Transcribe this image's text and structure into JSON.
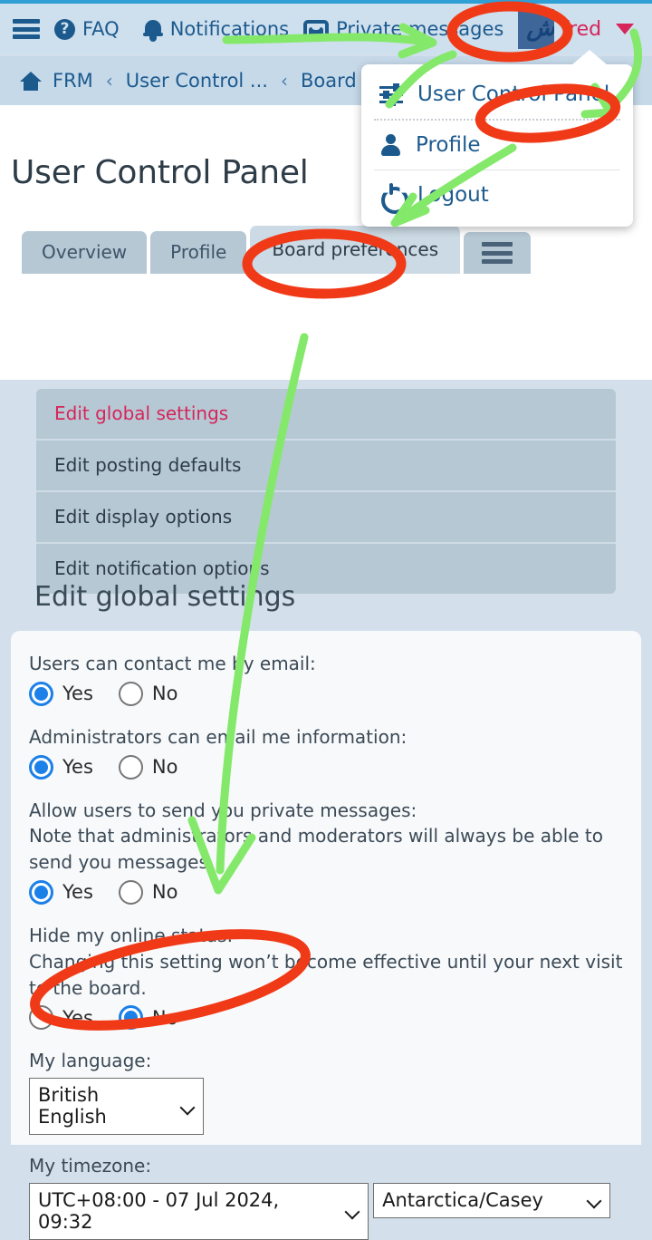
{
  "header": {
    "menu_icon": "hamburger-icon",
    "faq_label": "FAQ",
    "notifications_label": "Notifications",
    "private_messages_label": "Private messages",
    "username": "fred",
    "username_color": "#d6255a",
    "accent_color": "#2f9fd4",
    "bar_color": "#cedfed",
    "avatar_emblem": "ش"
  },
  "breadcrumb": {
    "home_label": "FRM",
    "separator": "‹",
    "items": [
      {
        "label": "User Control ..."
      },
      {
        "label": "Board p"
      }
    ]
  },
  "page": {
    "title": "User Control Panel"
  },
  "tabs": [
    {
      "label": "Overview",
      "active": false
    },
    {
      "label": "Profile",
      "active": false
    },
    {
      "label": "Board preferences",
      "active": true
    }
  ],
  "tab_menu_icon": "hamburger-icon",
  "subnav": [
    {
      "label": "Edit global settings",
      "active": true
    },
    {
      "label": "Edit posting defaults",
      "active": false
    },
    {
      "label": "Edit display options",
      "active": false
    },
    {
      "label": "Edit notification options",
      "active": false
    }
  ],
  "section": {
    "heading": "Edit global settings"
  },
  "form": {
    "fields": [
      {
        "label": "Users can contact me by email:",
        "note": "",
        "type": "radio",
        "yes_label": "Yes",
        "no_label": "No",
        "value": "Yes"
      },
      {
        "label": "Administrators can email me information:",
        "note": "",
        "type": "radio",
        "yes_label": "Yes",
        "no_label": "No",
        "value": "Yes"
      },
      {
        "label": "Allow users to send you private messages:",
        "note": "Note that administrators and moderators will always be able to send you messages.",
        "type": "radio",
        "yes_label": "Yes",
        "no_label": "No",
        "value": "Yes"
      },
      {
        "label": "Hide my online status:",
        "note": "Changing this setting won’t become effective until your next visit to the board.",
        "type": "radio",
        "yes_label": "Yes",
        "no_label": "No",
        "value": "No"
      }
    ],
    "language": {
      "label": "My language:",
      "value": "British English"
    },
    "timezone": {
      "label": "My timezone:",
      "value": "UTC+08:00 - 07 Jul 2024, 09:32",
      "city_value": "Antarctica/Casey"
    }
  },
  "user_menu": {
    "items": [
      {
        "label": "User Control Panel",
        "icon": "sliders-icon"
      },
      {
        "label": "Profile",
        "icon": "person-icon"
      },
      {
        "label": "Logout",
        "icon": "power-icon"
      }
    ]
  },
  "annotations": {
    "highlight_color": "#f03a17",
    "arrow_color": "#84e96a"
  }
}
